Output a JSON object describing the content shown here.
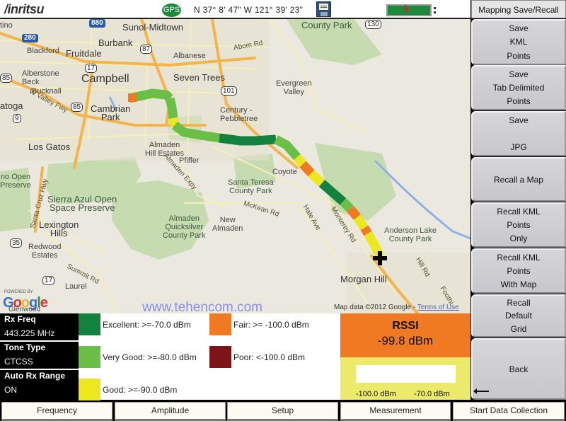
{
  "header": {
    "logo": "/inritsu",
    "gps_label": "GPS",
    "gps_coordinates": "N 37° 8' 47\" W 121° 39' 23\"",
    "icons": [
      "save-disk-icon",
      "battery-charging-icon"
    ]
  },
  "map": {
    "labels": {
      "sunol_midtown": "Sunol-Midtown",
      "burbank": "Burbank",
      "blackford": "Blackford",
      "fruitdale": "Fruitdale",
      "alberstone_beck": "Alberstone\nBeck",
      "campbell": "Campbell",
      "bucknall": "Bucknall",
      "saratoga": "atoga",
      "cambrian_park": "Cambrian\nPark",
      "los_gatos": "Los Gatos",
      "albanese": "Albanese",
      "seven_trees": "Seven Trees",
      "century_pebbletree": "Century -\nPebbletree",
      "evergreen_valley": "Evergreen\nValley",
      "grant_park": "County Park",
      "abom_rd": "Abom Rd",
      "almaden_hill_estates": "Almaden\nHill Estates",
      "pfiffer": "Pfiffer",
      "almaden_expy": "Almaden Expy",
      "coyote": "Coyote",
      "santa_teresa": "Santa Teresa\nCounty Park",
      "sierra_azul": "Sierra Azul Open\nSpace Preserve",
      "reno_open": "no Open\nPreserve",
      "lexington_hills": "Lexington\nHills",
      "redwood_estates": "Redwood\nEstates",
      "almaden_quicksilver": "Almaden\nQuicksilver\nCounty Park",
      "new_almaden": "New\nAlmaden",
      "mckean_rd": "McKean Rd",
      "hale_ave": "Hale Ave",
      "monterey_rd": "Monterey Rd",
      "anderson_lake": "Anderson Lake\nCounty Park",
      "morgan_hill": "Morgan Hill",
      "hill_rd": "Hill Rd",
      "foothill": "Foothi",
      "summit_rd": "Summit Rd",
      "laurel": "Laurel",
      "glenwood": "Glenwood",
      "santa_cruz_hwy": "Santa Cruz Hwy",
      "w_valley_fwy": "W Valley Fwy",
      "tino": "tino"
    },
    "shields": {
      "i880": "880",
      "i280": "280",
      "r87": "87",
      "r17_north": "17",
      "r85_west": "85",
      "r85": "85",
      "r9": "9",
      "r101": "101",
      "r130": "130",
      "r35": "35",
      "r17_south": "17"
    },
    "powered_by": "POWERED BY",
    "google": [
      "G",
      "o",
      "o",
      "g",
      "l",
      "e"
    ],
    "watermark": "www.tehencom.com",
    "map_data": "Map data ©2012 Google - ",
    "terms": "Terms of Use"
  },
  "info_panel": [
    {
      "label": "Rx Freq",
      "value": "443.225 MHz"
    },
    {
      "label": "Tone Type",
      "value": "CTCSS"
    },
    {
      "label": "Auto Rx Range",
      "value": "ON"
    }
  ],
  "legend": [
    {
      "label": "Excellent: >=-70.0 dBm",
      "color": "#14823f"
    },
    {
      "label": "Very Good: >=-80.0 dBm",
      "color": "#6abf46"
    },
    {
      "label": "Good: >=-90.0 dBm",
      "color": "#ede81e"
    },
    {
      "label": "Fair: >= -100.0 dBm",
      "color": "#f07a22"
    },
    {
      "label": "Poor: <-100.0 dBm",
      "color": "#7d1518"
    }
  ],
  "rssi": {
    "title": "RSSI",
    "value": "-99.8 dBm",
    "bar_fraction": 0.0,
    "min_label": "-100.0 dBm",
    "max_label": "-70.0 dBm",
    "bg_color": "#f07a22"
  },
  "softkeys": {
    "title": "Mapping Save/Recall",
    "buttons": [
      {
        "lines": [
          "Save",
          "KML",
          "Points"
        ]
      },
      {
        "lines": [
          "Save",
          "Tab Delimited",
          "Points"
        ]
      },
      {
        "lines": [
          "Save",
          "",
          "JPG"
        ]
      },
      {
        "lines": [
          "Recall a Map"
        ]
      },
      {
        "lines": [
          "Recall KML",
          "Points",
          "Only"
        ]
      },
      {
        "lines": [
          "Recall KML",
          "Points",
          "With Map"
        ]
      },
      {
        "lines": [
          "Recall",
          "Default",
          "Grid"
        ]
      },
      {
        "lines": [
          "Back"
        ]
      }
    ]
  },
  "function_keys": [
    "Frequency",
    "Amplitude",
    "Setup",
    "Measurement",
    "Start Data Collection"
  ]
}
